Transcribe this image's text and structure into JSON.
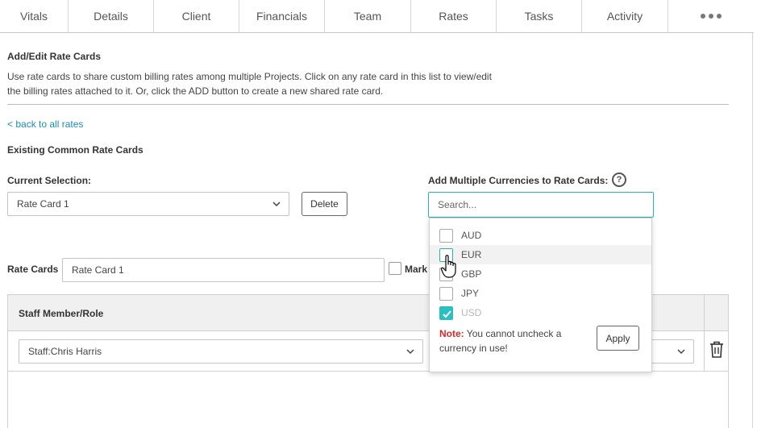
{
  "tabs": [
    "Vitals",
    "Details",
    "Client",
    "Financials",
    "Team",
    "Rates",
    "Tasks",
    "Activity"
  ],
  "more_icon": "more-horizontal-icon",
  "header": {
    "title": "Add/Edit Rate Cards",
    "description_line1": "Use rate cards to share custom billing rates among multiple Projects. Click on any rate card in this list to view/edit",
    "description_line2": "the billing rates attached to it. Or, click the ADD button to create a new shared rate card.",
    "back_link": "< back to all rates"
  },
  "existing": {
    "title": "Existing Common Rate Cards",
    "current_selection_label": "Current Selection:",
    "current_selection_value": "Rate Card 1",
    "delete_label": "Delete"
  },
  "currencies": {
    "label": "Add Multiple Currencies to Rate Cards:",
    "search_placeholder": "Search...",
    "options": [
      {
        "code": "AUD",
        "checked": false,
        "disabled": false
      },
      {
        "code": "EUR",
        "checked": false,
        "disabled": false
      },
      {
        "code": "GBP",
        "checked": false,
        "disabled": false
      },
      {
        "code": "JPY",
        "checked": false,
        "disabled": false
      },
      {
        "code": "USD",
        "checked": true,
        "disabled": true
      }
    ],
    "note_prefix": "Note:",
    "note_text": " You cannot uncheck a currency in use!",
    "apply_label": "Apply",
    "accent_color": "#2bc0c0"
  },
  "rate_card": {
    "label": "Rate Cards",
    "name_value": "Rate Card 1",
    "mark_label": "Mark"
  },
  "table": {
    "column_staff": "Staff Member/Role",
    "row_staff_value": "Staff:Chris Harris"
  }
}
